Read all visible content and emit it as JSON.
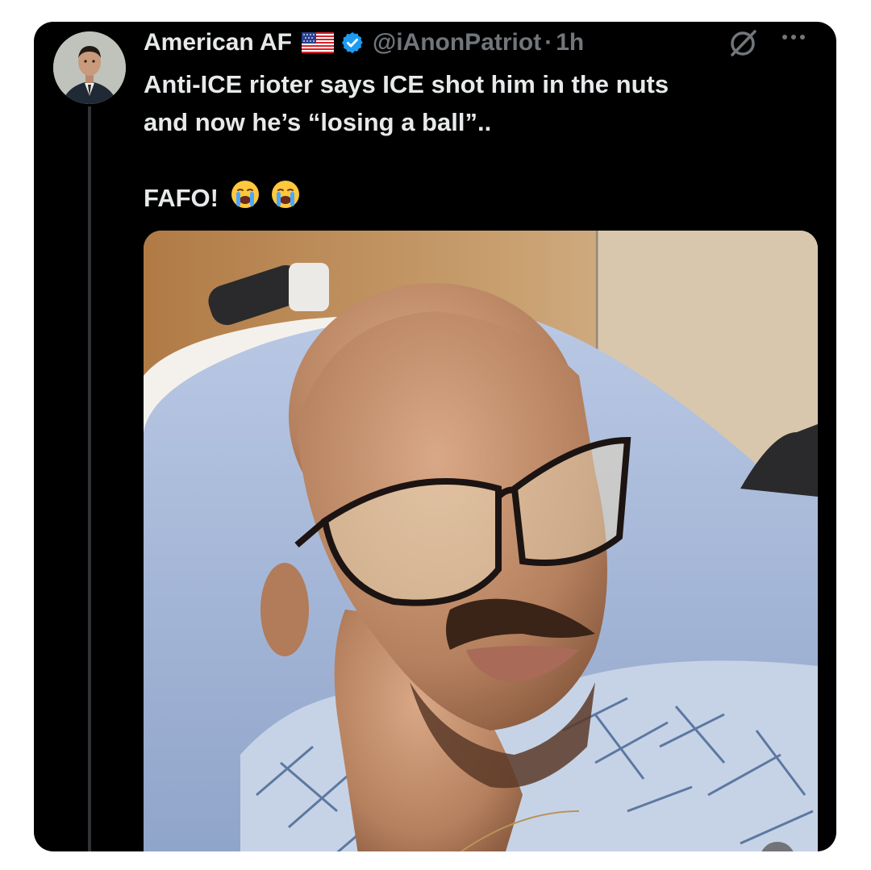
{
  "tweet": {
    "display_name": "American AF",
    "handle": "@iAnonPatriot",
    "separator": "·",
    "time": "1h",
    "text_line_1": "Anti-ICE rioter says ICE shot him in the nuts",
    "text_line_2": "and now he’s “losing a ball”..",
    "text_line_3": "FAFO!",
    "flag_icon": "us-flag-icon",
    "verified_icon": "verified-badge-icon",
    "emoji": [
      "loudly-crying-face",
      "loudly-crying-face"
    ]
  },
  "colors": {
    "background": "#000000",
    "text": "#e7e9ea",
    "muted": "#71767b",
    "verified": "#1d9bf0"
  }
}
